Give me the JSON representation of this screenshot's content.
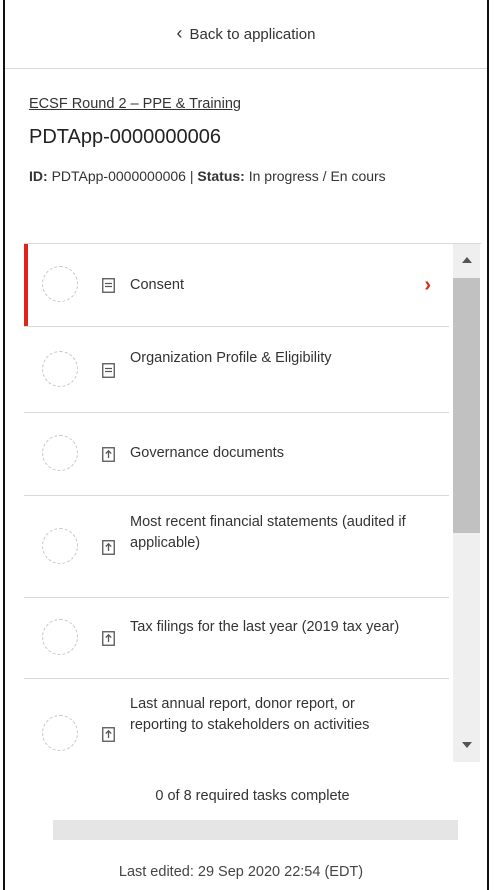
{
  "back": {
    "label": "Back to application"
  },
  "header": {
    "program_link": "ECSF Round 2 – PPE & Training",
    "title": "PDTApp-0000000006",
    "id_label": "ID:",
    "id_value": "PDTApp-0000000006",
    "separator": "|",
    "status_label": "Status:",
    "status_value": "In progress / En cours"
  },
  "tasks": [
    {
      "label": "Consent",
      "icon": "document-icon",
      "active": true
    },
    {
      "label": "Organization Profile & Eligibility",
      "icon": "document-icon",
      "active": false
    },
    {
      "label": "Governance documents",
      "icon": "upload-icon",
      "active": false
    },
    {
      "label": "Most recent financial statements (audited if applicable)",
      "icon": "upload-icon",
      "active": false
    },
    {
      "label": "Tax filings for the last year (2019 tax year)",
      "icon": "upload-icon",
      "active": false
    },
    {
      "label": "Last annual report, donor report, or reporting to stakeholders on activities",
      "icon": "upload-icon",
      "active": false
    }
  ],
  "progress": {
    "text": "0 of 8 required tasks complete",
    "completed": 0,
    "required": 8
  },
  "footer": {
    "last_edited": "Last edited: 29 Sep 2020 22:54 (EDT)"
  },
  "colors": {
    "accent": "#e2231a",
    "border": "#d9d9d9",
    "scroll_track": "#efefef",
    "scroll_thumb": "#c1c1c1"
  }
}
